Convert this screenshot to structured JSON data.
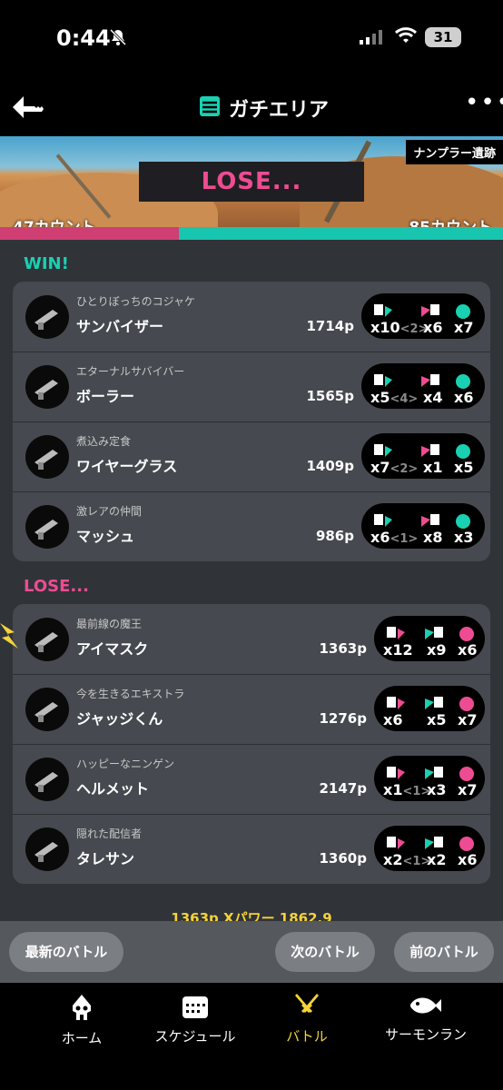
{
  "status_bar": {
    "time": "0:44",
    "battery": "31"
  },
  "header": {
    "title": "ガチエリア"
  },
  "stage": {
    "name": "ナンプラー遺跡",
    "result": "LOSE...",
    "left_count": "47カウント",
    "right_count": "85カウント"
  },
  "win_section": {
    "label": "WIN!",
    "players": [
      {
        "title": "ひとりぼっちのコジャケ",
        "name": "サンバイザー",
        "power": "1714p",
        "kills": "x10",
        "assists": "<2>",
        "deaths": "x6",
        "special": "x7"
      },
      {
        "title": "エターナルサバイバー",
        "name": "ボーラー",
        "power": "1565p",
        "kills": "x5",
        "assists": "<4>",
        "deaths": "x4",
        "special": "x6"
      },
      {
        "title": "煮込み定食",
        "name": "ワイヤーグラス",
        "power": "1409p",
        "kills": "x7",
        "assists": "<2>",
        "deaths": "x1",
        "special": "x5"
      },
      {
        "title": "激レアの仲間",
        "name": "マッシュ",
        "power": "986p",
        "kills": "x6",
        "assists": "<1>",
        "deaths": "x8",
        "special": "x3"
      }
    ]
  },
  "lose_section": {
    "label": "LOSE...",
    "players": [
      {
        "title": "最前線の魔王",
        "name": "アイマスク",
        "power": "1363p",
        "kills": "x12",
        "assists": "",
        "deaths": "x9",
        "special": "x6"
      },
      {
        "title": "今を生きるエキストラ",
        "name": "ジャッジくん",
        "power": "1276p",
        "kills": "x6",
        "assists": "",
        "deaths": "x5",
        "special": "x7"
      },
      {
        "title": "ハッピーなニンゲン",
        "name": "ヘルメット",
        "power": "2147p",
        "kills": "x1",
        "assists": "<1>",
        "deaths": "x3",
        "special": "x7"
      },
      {
        "title": "隠れた配信者",
        "name": "タレサン",
        "power": "1360p",
        "kills": "x2",
        "assists": "<1>",
        "deaths": "x2",
        "special": "x6"
      }
    ]
  },
  "summary_peek": "1363p Xパワー 1862.9",
  "buttons": {
    "latest": "最新のバトル",
    "next": "次のバトル",
    "prev": "前のバトル"
  },
  "tabs": [
    {
      "label": "ホーム",
      "icon": "squid-icon"
    },
    {
      "label": "スケジュール",
      "icon": "calendar-icon"
    },
    {
      "label": "バトル",
      "icon": "battle-icon"
    },
    {
      "label": "サーモンラン",
      "icon": "salmon-icon"
    }
  ],
  "colors": {
    "win": "#19d1b2",
    "lose": "#ee4c92",
    "active_tab": "#f5d33a"
  }
}
